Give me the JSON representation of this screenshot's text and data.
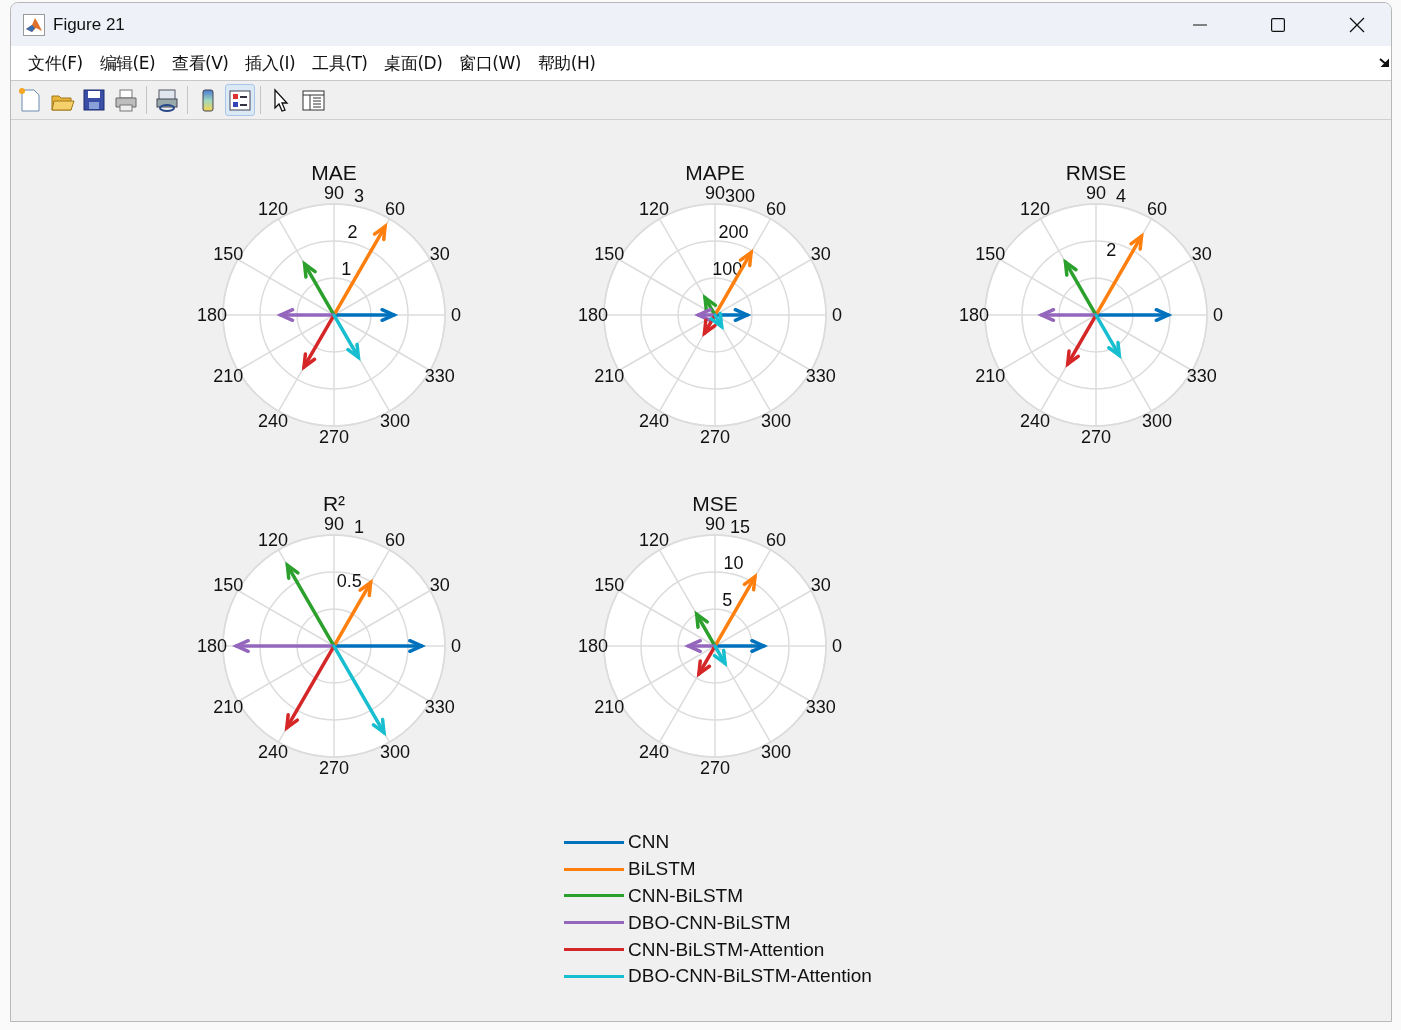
{
  "window": {
    "title": "Figure 21"
  },
  "menu": [
    {
      "label": "文件(F)"
    },
    {
      "label": "编辑(E)"
    },
    {
      "label": "查看(V)"
    },
    {
      "label": "插入(I)"
    },
    {
      "label": "工具(T)"
    },
    {
      "label": "桌面(D)"
    },
    {
      "label": "窗口(W)"
    },
    {
      "label": "帮助(H)"
    }
  ],
  "toolbar": [
    {
      "kind": "new",
      "on": false
    },
    {
      "kind": "open",
      "on": false
    },
    {
      "kind": "save",
      "on": false
    },
    {
      "kind": "print",
      "on": false
    },
    {
      "kind": "link",
      "on": false
    },
    {
      "kind": "colorbar",
      "on": false
    },
    {
      "kind": "legend",
      "on": true
    },
    {
      "kind": "pointer",
      "on": false
    },
    {
      "kind": "inspector",
      "on": false
    }
  ],
  "plots": [
    {
      "title": "MAE",
      "angle_labels": [
        "0",
        "30",
        "60",
        "90",
        "120",
        "150",
        "180",
        "210",
        "240",
        "270",
        "300",
        "330"
      ],
      "radius_labels": [
        "3",
        "2",
        "1"
      ],
      "arrows": [
        {
          "color": "#0072bd",
          "level": 0.54
        },
        {
          "color": "#ff7f0e",
          "level": 0.92
        },
        {
          "color": "#2ca02c",
          "level": 0.53
        },
        {
          "color": "#9467bd",
          "level": 0.48
        },
        {
          "color": "#d62728",
          "level": 0.54
        },
        {
          "color": "#17becf",
          "level": 0.44
        }
      ]
    },
    {
      "title": "MAPE",
      "angle_labels": [
        "0",
        "30",
        "60",
        "90",
        "120",
        "150",
        "180",
        "210",
        "240",
        "270",
        "300",
        "330"
      ],
      "radius_labels": [
        "300",
        "200",
        "100"
      ],
      "arrows": [
        {
          "color": "#0072bd",
          "level": 0.29
        },
        {
          "color": "#ff7f0e",
          "level": 0.65
        },
        {
          "color": "#2ca02c",
          "level": 0.18
        },
        {
          "color": "#9467bd",
          "level": 0.15
        },
        {
          "color": "#d62728",
          "level": 0.19
        },
        {
          "color": "#17becf",
          "level": 0.12
        }
      ]
    },
    {
      "title": "RMSE",
      "angle_labels": [
        "0",
        "30",
        "60",
        "90",
        "120",
        "150",
        "180",
        "210",
        "240",
        "270",
        "300",
        "330"
      ],
      "radius_labels": [
        "4",
        "2"
      ],
      "arrows": [
        {
          "color": "#0072bd",
          "level": 0.65
        },
        {
          "color": "#ff7f0e",
          "level": 0.82
        },
        {
          "color": "#2ca02c",
          "level": 0.55
        },
        {
          "color": "#9467bd",
          "level": 0.49
        },
        {
          "color": "#d62728",
          "level": 0.51
        },
        {
          "color": "#17becf",
          "level": 0.42
        }
      ]
    },
    {
      "title": "R²",
      "angle_labels": [
        "0",
        "30",
        "60",
        "90",
        "120",
        "150",
        "180",
        "210",
        "240",
        "270",
        "300",
        "330"
      ],
      "radius_labels": [
        "1",
        "0.5"
      ],
      "arrows": [
        {
          "color": "#0072bd",
          "level": 0.79
        },
        {
          "color": "#ff7f0e",
          "level": 0.66
        },
        {
          "color": "#2ca02c",
          "level": 0.84
        },
        {
          "color": "#9467bd",
          "level": 0.88
        },
        {
          "color": "#d62728",
          "level": 0.85
        },
        {
          "color": "#17becf",
          "level": 0.9
        }
      ]
    },
    {
      "title": "MSE",
      "angle_labels": [
        "0",
        "30",
        "60",
        "90",
        "120",
        "150",
        "180",
        "210",
        "240",
        "270",
        "300",
        "330"
      ],
      "radius_labels": [
        "15",
        "10",
        "5"
      ],
      "arrows": [
        {
          "color": "#0072bd",
          "level": 0.44
        },
        {
          "color": "#ff7f0e",
          "level": 0.72
        },
        {
          "color": "#2ca02c",
          "level": 0.33
        },
        {
          "color": "#9467bd",
          "level": 0.24
        },
        {
          "color": "#d62728",
          "level": 0.29
        },
        {
          "color": "#17becf",
          "level": 0.18
        }
      ]
    }
  ],
  "legend": [
    {
      "label": "CNN",
      "color": "#0072bd"
    },
    {
      "label": "BiLSTM",
      "color": "#ff7f0e"
    },
    {
      "label": "CNN-BiLSTM",
      "color": "#2ca02c"
    },
    {
      "label": "DBO-CNN-BiLSTM",
      "color": "#9467bd"
    },
    {
      "label": "CNN-BiLSTM-Attention",
      "color": "#d62728"
    },
    {
      "label": "DBO-CNN-BiLSTM-Attention",
      "color": "#17becf"
    }
  ]
}
